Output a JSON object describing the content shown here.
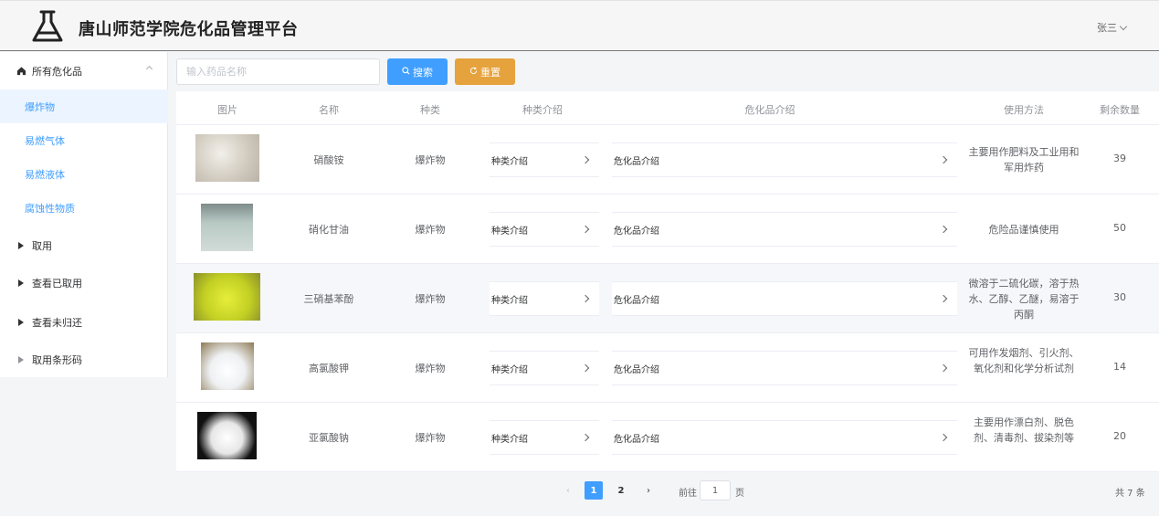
{
  "header": {
    "title": "唐山师范学院危化品管理平台",
    "user": "张三"
  },
  "sidebar": {
    "group_all": "所有危化品",
    "sub_items": [
      "爆炸物",
      "易燃气体",
      "易燃液体",
      "腐蚀性物质"
    ],
    "groups": [
      "取用",
      "查看已取用",
      "查看未归还",
      "取用条形码"
    ]
  },
  "search": {
    "placeholder": "输入药品名称",
    "search_label": "搜索",
    "reset_label": "重置"
  },
  "table": {
    "columns": [
      "图片",
      "名称",
      "种类",
      "种类介绍",
      "危化品介绍",
      "使用方法",
      "剩余数量"
    ],
    "rows": [
      {
        "name": "硝酸铵",
        "category": "爆炸物",
        "category_intro": "种类介绍",
        "hazard_intro": "危化品介绍",
        "usage": "主要用作肥料及工业用和军用炸药",
        "qty": "39",
        "image_color": "#d8d4cc"
      },
      {
        "name": "硝化甘油",
        "category": "爆炸物",
        "category_intro": "种类介绍",
        "hazard_intro": "危化品介绍",
        "usage": "危险品谨慎使用",
        "qty": "50",
        "image_color": "#9fb3ad"
      },
      {
        "name": "三硝基苯酚",
        "category": "爆炸物",
        "category_intro": "种类介绍",
        "hazard_intro": "危化品介绍",
        "usage": "微溶于二硫化碳，溶于热水、乙醇、乙醚，易溶于丙酮",
        "qty": "30",
        "image_color": "#c7d42a"
      },
      {
        "name": "高氯酸钾",
        "category": "爆炸物",
        "category_intro": "种类介绍",
        "hazard_intro": "危化品介绍",
        "usage": "可用作发烟剂、引火剂、氧化剂和化学分析试剂",
        "qty": "14",
        "image_color": "#e9ecef"
      },
      {
        "name": "亚氯酸钠",
        "category": "爆炸物",
        "category_intro": "种类介绍",
        "hazard_intro": "危化品介绍",
        "usage": "主要用作漂白剂、脱色剂、清毒剂、拔染剂等",
        "qty": "20",
        "image_color": "#ececec"
      }
    ]
  },
  "pagination": {
    "pages": [
      "1",
      "2"
    ],
    "current": "1",
    "goto_prefix": "前往",
    "goto_value": "1",
    "goto_suffix": "页",
    "total": "共 7 条"
  },
  "colors": {
    "primary": "#409eff",
    "warning": "#e6a23c"
  }
}
